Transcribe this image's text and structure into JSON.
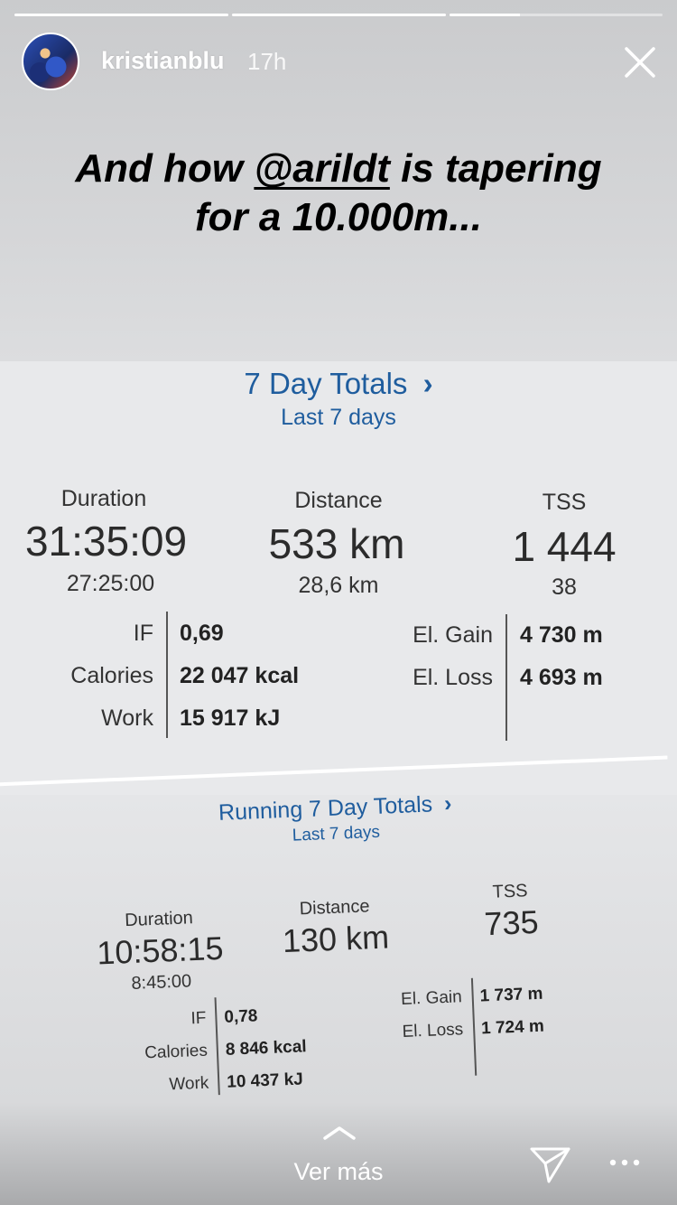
{
  "progress": [
    1.0,
    1.0,
    0.33
  ],
  "header": {
    "username": "kristianblu",
    "timestamp": "17h"
  },
  "caption": {
    "before": "And how ",
    "mention": "@arildt",
    "after": " is tapering for a 10.000m..."
  },
  "totals": {
    "title": "7 Day Totals",
    "chevron": "›",
    "subtitle": "Last 7 days",
    "duration": {
      "label": "Duration",
      "value": "31:35:09",
      "sub": "27:25:00"
    },
    "distance": {
      "label": "Distance",
      "value": "533 km",
      "sub": "28,6 km"
    },
    "tss": {
      "label": "TSS",
      "value": "1 444",
      "sub": "38"
    },
    "if": {
      "label": "IF",
      "value": "0,69"
    },
    "calories": {
      "label": "Calories",
      "value": "22 047 kcal"
    },
    "work": {
      "label": "Work",
      "value": "15 917 kJ"
    },
    "el_gain": {
      "label": "El. Gain",
      "value": "4 730 m"
    },
    "el_loss": {
      "label": "El. Loss",
      "value": "4 693 m"
    }
  },
  "running": {
    "title": "Running 7 Day Totals",
    "chevron": "›",
    "subtitle": "Last 7 days",
    "duration": {
      "label": "Duration",
      "value": "10:58:15",
      "sub": "8:45:00"
    },
    "distance": {
      "label": "Distance",
      "value": "130 km"
    },
    "tss": {
      "label": "TSS",
      "value": "735"
    },
    "if": {
      "label": "IF",
      "value": "0,78"
    },
    "calories": {
      "label": "Calories",
      "value": "8 846 kcal"
    },
    "work": {
      "label": "Work",
      "value": "10 437 kJ"
    },
    "el_gain": {
      "label": "El. Gain",
      "value": "1 737 m"
    },
    "el_loss": {
      "label": "El. Loss",
      "value": "1 724 m"
    }
  },
  "footer": {
    "ver_mas": "Ver más"
  },
  "icons": {
    "close": "close-icon",
    "chevron_up": "chevron-up-icon",
    "send": "paper-plane-icon",
    "more": "more-dots-icon"
  },
  "colors": {
    "link_blue": "#1f5d9e",
    "text_dark": "#2b2b2b"
  }
}
